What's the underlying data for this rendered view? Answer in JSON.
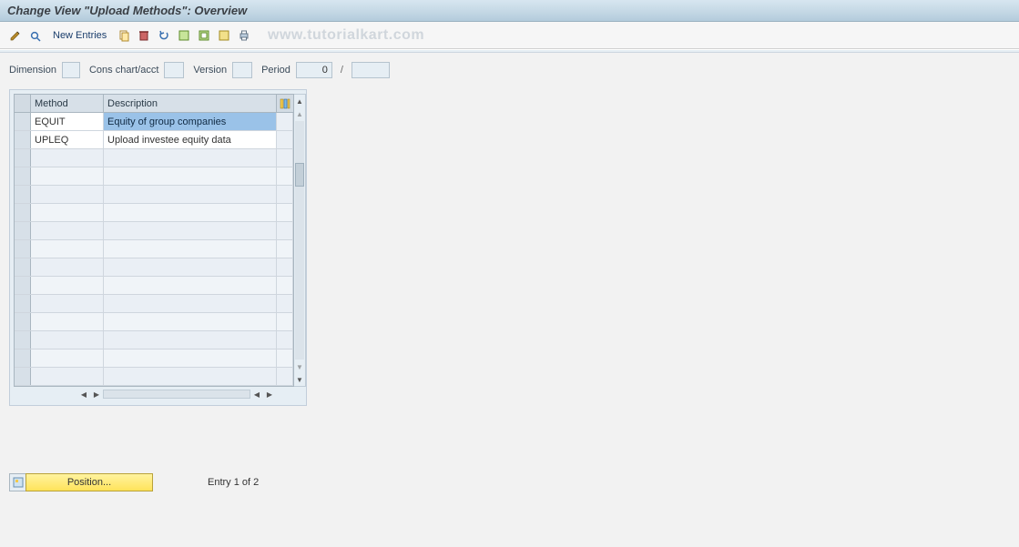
{
  "title": "Change View \"Upload Methods\": Overview",
  "toolbar": {
    "new_entries": "New Entries"
  },
  "watermark": "www.tutorialkart.com",
  "params": {
    "dimension_label": "Dimension",
    "cons_label": "Cons chart/acct",
    "version_label": "Version",
    "period_label": "Period",
    "period_val": "0",
    "period_sep": "/"
  },
  "table": {
    "headers": {
      "method": "Method",
      "description": "Description"
    },
    "rows": [
      {
        "method": "EQUIT",
        "description": "Equity of group companies"
      },
      {
        "method": "UPLEQ",
        "description": "Upload investee equity data"
      }
    ]
  },
  "footer": {
    "position_btn": "Position...",
    "entry_text": "Entry 1 of 2"
  }
}
